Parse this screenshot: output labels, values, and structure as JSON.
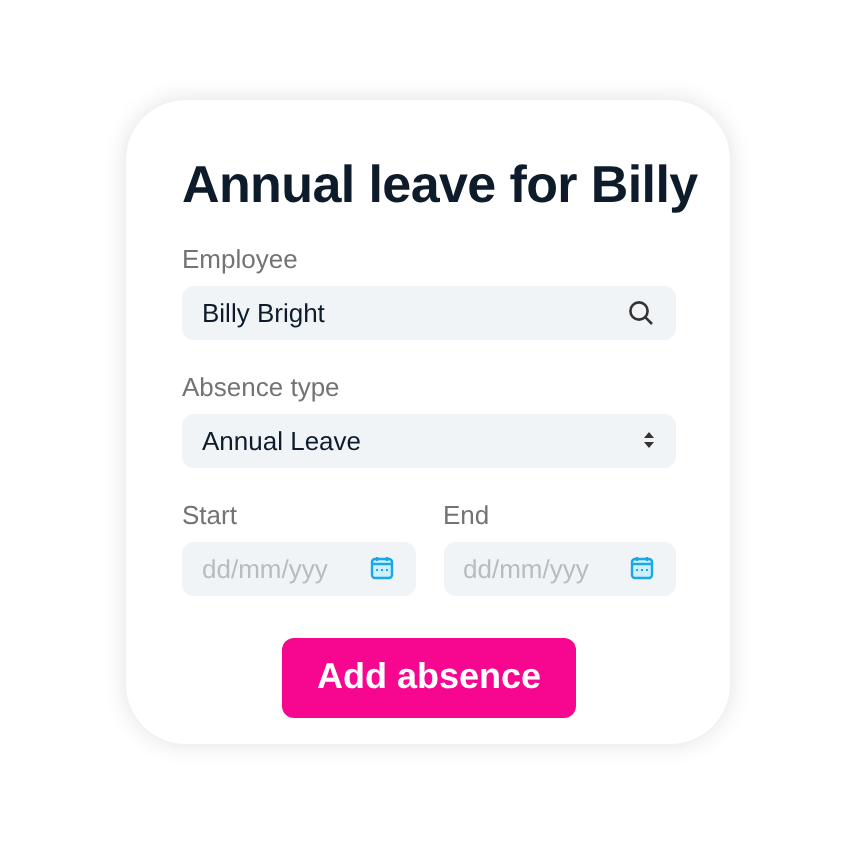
{
  "title": "Annual leave for Billy",
  "employee": {
    "label": "Employee",
    "value": "Billy Bright"
  },
  "absence_type": {
    "label": "Absence type",
    "value": "Annual Leave"
  },
  "dates": [
    {
      "label": "Start",
      "placeholder": "dd/mm/yyy"
    },
    {
      "label": "End",
      "placeholder": "dd/mm/yyy"
    }
  ],
  "button": "Add absence"
}
